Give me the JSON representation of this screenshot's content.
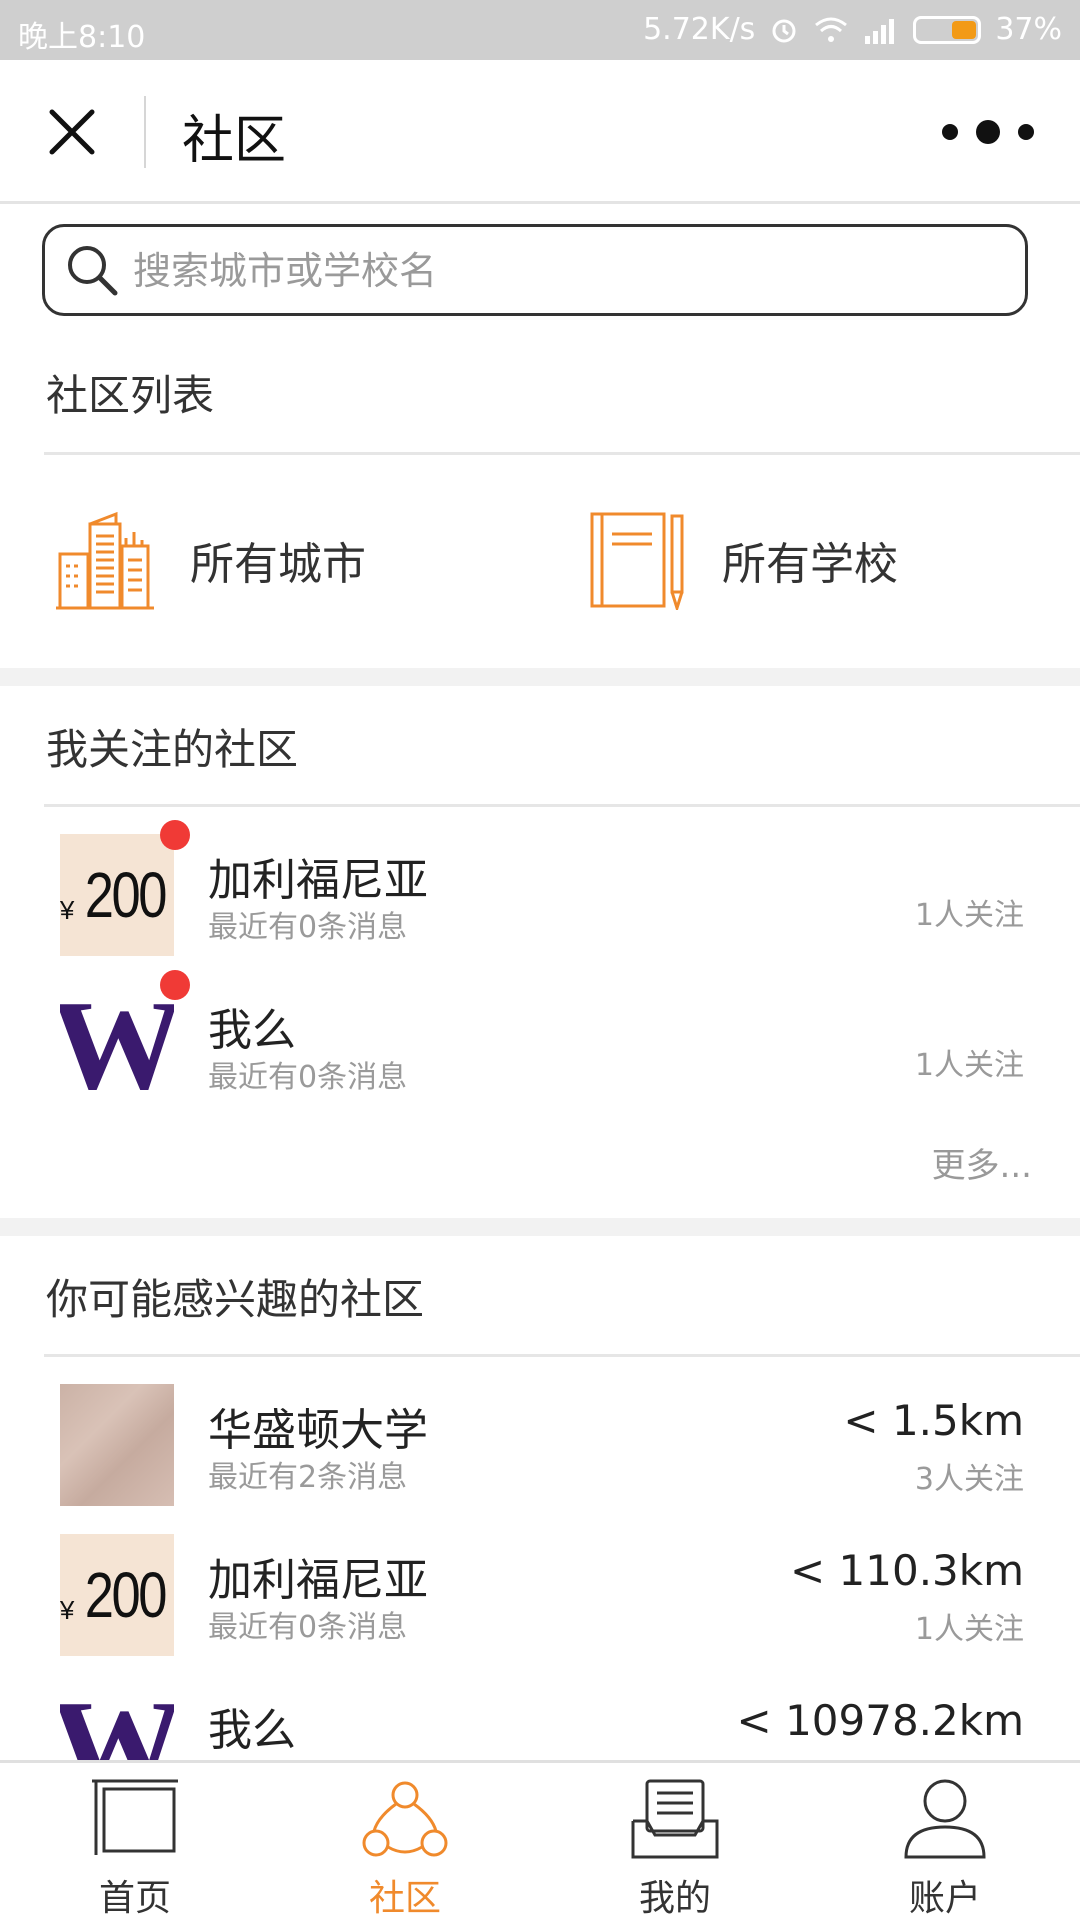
{
  "status_bar": {
    "time": "晚上8:10",
    "net_speed": "5.72K/s",
    "battery": "37%"
  },
  "nav": {
    "title": "社区"
  },
  "search": {
    "placeholder": "搜索城市或学校名"
  },
  "community_list": {
    "title": "社区列表",
    "categories": [
      {
        "label": "所有城市",
        "icon": "buildings-icon"
      },
      {
        "label": "所有学校",
        "icon": "notebook-pen-icon"
      }
    ]
  },
  "followed": {
    "title": "我关注的社区",
    "items": [
      {
        "name": "加利福尼亚",
        "sub": "最近有0条消息",
        "followers": "1人关注",
        "thumb": "price-tag-200",
        "thumb_text": "200",
        "thumb_prefix": "¥",
        "unread": true
      },
      {
        "name": "我么",
        "sub": "最近有0条消息",
        "followers": "1人关注",
        "thumb": "w-logo",
        "thumb_text": "W",
        "unread": true
      }
    ],
    "more": "更多..."
  },
  "interest": {
    "title": "你可能感兴趣的社区",
    "items": [
      {
        "name": "华盛顿大学",
        "sub": "最近有2条消息",
        "distance": "< 1.5km",
        "followers": "3人关注",
        "thumb": "texture"
      },
      {
        "name": "加利福尼亚",
        "sub": "最近有0条消息",
        "distance": "< 110.3km",
        "followers": "1人关注",
        "thumb": "price-tag-200",
        "thumb_text": "200",
        "thumb_prefix": "¥"
      },
      {
        "name": "我么",
        "distance": "< 10978.2km",
        "thumb": "w-logo",
        "thumb_text": "W"
      }
    ]
  },
  "tabs": [
    {
      "label": "首页",
      "icon": "home-frame-icon"
    },
    {
      "label": "社区",
      "icon": "community-icon",
      "active": true
    },
    {
      "label": "我的",
      "icon": "inbox-doc-icon"
    },
    {
      "label": "账户",
      "icon": "user-icon"
    }
  ],
  "colors": {
    "accent": "#f08a2c",
    "badge": "#f03a36",
    "status_bar": "#cfcfcf"
  }
}
